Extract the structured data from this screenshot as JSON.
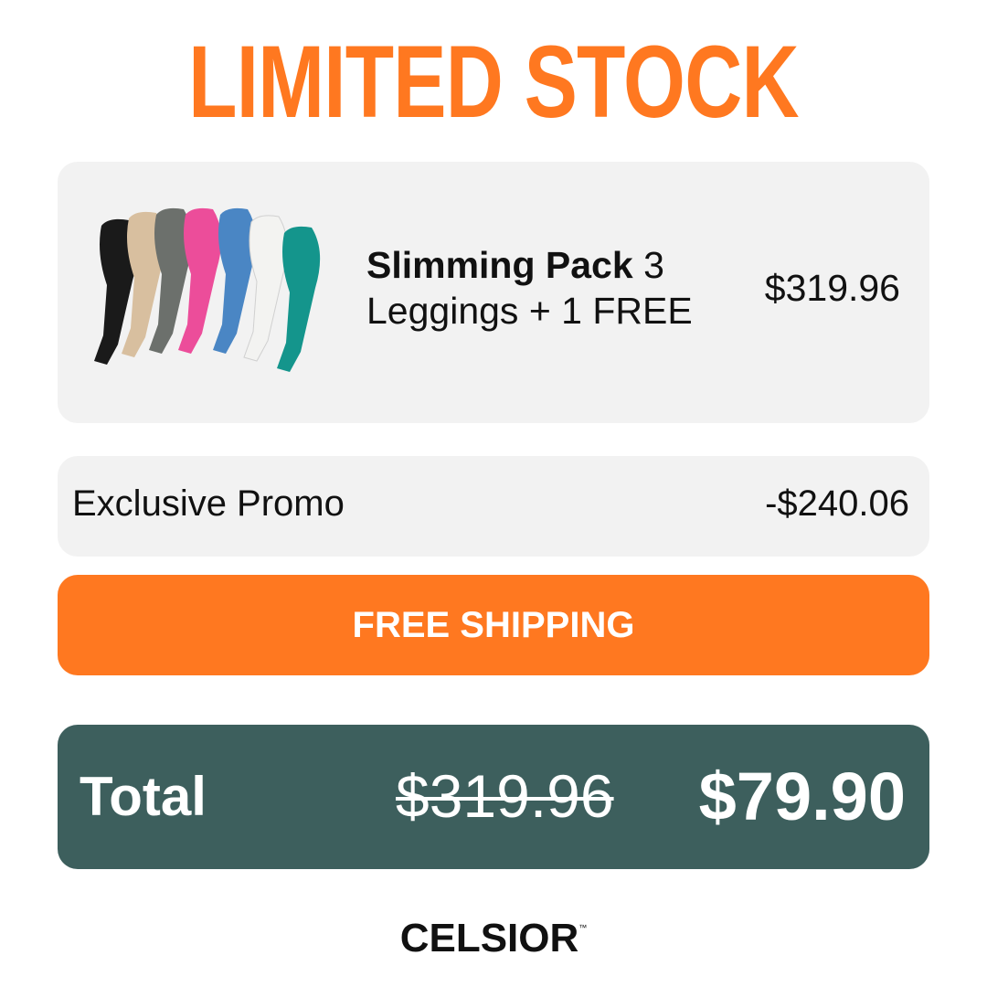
{
  "headline": "LIMITED STOCK",
  "product": {
    "name_bold": "Slimming Pack",
    "name_rest": " 3 Leggings + 1 FREE",
    "price": "$319.96",
    "legging_colors": [
      "#1a1a1a",
      "#d8bf9f",
      "#6c706c",
      "#ec4d9a",
      "#4a86c4",
      "#f3f3f1",
      "#14958c"
    ]
  },
  "promo": {
    "label": "Exclusive Promo",
    "value": "-$240.06"
  },
  "shipping": {
    "label": "FREE SHIPPING"
  },
  "total": {
    "label": "Total",
    "old_price": "$319.96",
    "new_price": "$79.90"
  },
  "brand": {
    "name": "CELSIOR",
    "tm": "™"
  },
  "colors": {
    "accent": "#ff7820",
    "total_bg": "#3d5f5d",
    "card_bg": "#f2f2f2"
  }
}
